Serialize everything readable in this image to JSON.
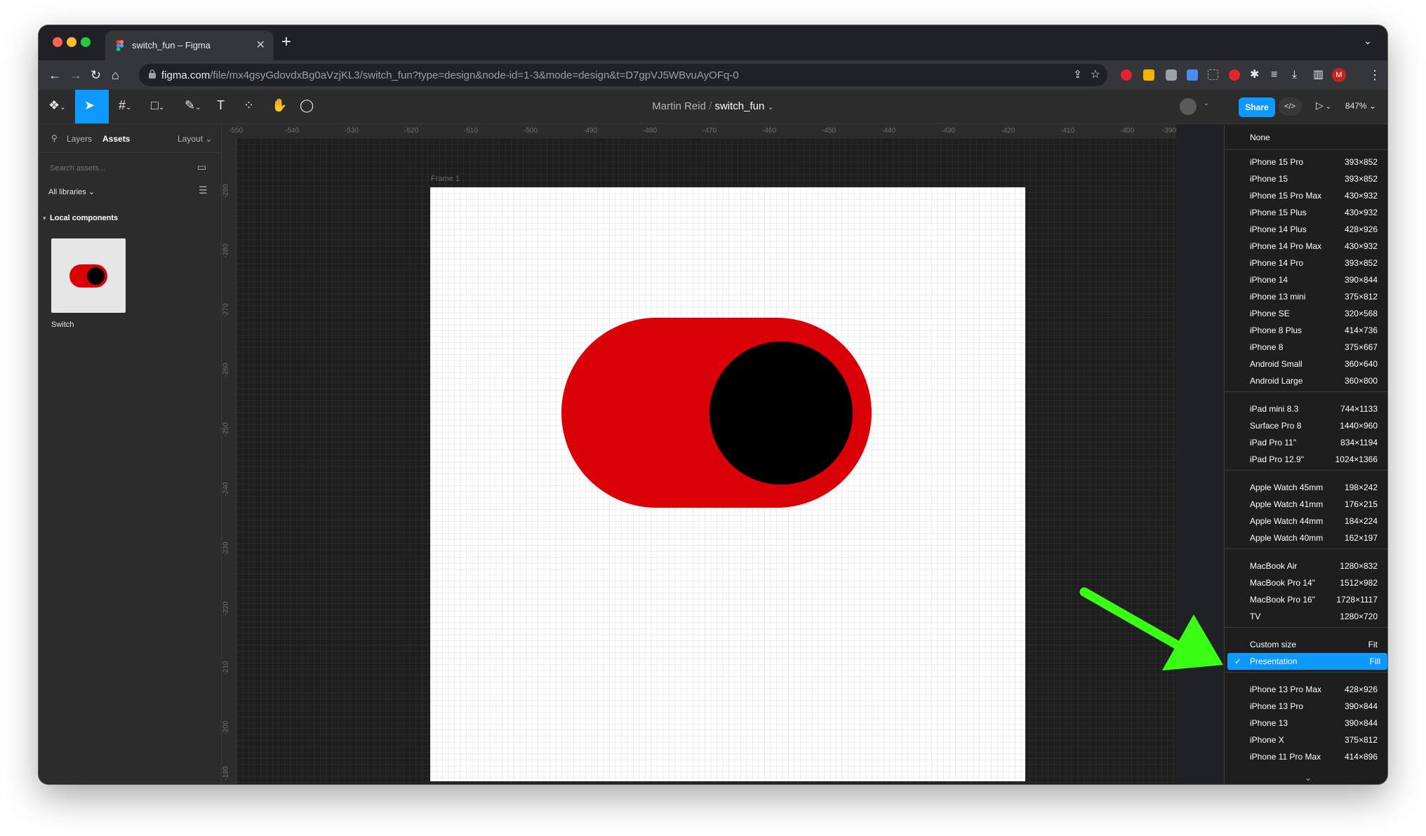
{
  "browser": {
    "tab_title": "switch_fun – Figma",
    "url_host": "figma.com",
    "url_path": "/file/mx4gsyGdovdxBg0aVzjKL3/switch_fun?type=design&node-id=1-3&mode=design&t=D7gpVJ5WBvuAyOFq-0",
    "profile_initial": "M"
  },
  "toolbar": {
    "owner": "Martin Reid",
    "file_name": "switch_fun",
    "share_label": "Share",
    "dev_mode_label": "</>",
    "zoom": "847%"
  },
  "left_panel": {
    "tabs": [
      "Layers",
      "Assets"
    ],
    "layout_label": "Layout",
    "search_placeholder": "Search assets...",
    "libraries_label": "All libraries",
    "section_label": "Local components",
    "component_name": "Switch"
  },
  "rulers": {
    "horizontal": [
      "-550",
      "-540",
      "-530",
      "-520",
      "-510",
      "-500",
      "-490",
      "-480",
      "-470",
      "-460",
      "-450",
      "-440",
      "-430",
      "-420",
      "-410",
      "-400",
      "-390"
    ],
    "vertical": [
      "-290",
      "-280",
      "-270",
      "-260",
      "-250",
      "-240",
      "-230",
      "-220",
      "-210",
      "-200",
      "-190"
    ]
  },
  "canvas": {
    "frame_label": "Frame 1",
    "colors": {
      "track": "#d90008",
      "knob": "#000000",
      "frame": "#ffffff"
    }
  },
  "menu": {
    "none_label": "None",
    "groups": [
      [
        {
          "name": "iPhone 15 Pro",
          "size": "393×852"
        },
        {
          "name": "iPhone 15",
          "size": "393×852"
        },
        {
          "name": "iPhone 15 Pro Max",
          "size": "430×932"
        },
        {
          "name": "iPhone 15 Plus",
          "size": "430×932"
        },
        {
          "name": "iPhone 14 Plus",
          "size": "428×926"
        },
        {
          "name": "iPhone 14 Pro Max",
          "size": "430×932"
        },
        {
          "name": "iPhone 14 Pro",
          "size": "393×852"
        },
        {
          "name": "iPhone 14",
          "size": "390×844"
        },
        {
          "name": "iPhone 13 mini",
          "size": "375×812"
        },
        {
          "name": "iPhone SE",
          "size": "320×568"
        },
        {
          "name": "iPhone 8 Plus",
          "size": "414×736"
        },
        {
          "name": "iPhone 8",
          "size": "375×667"
        },
        {
          "name": "Android Small",
          "size": "360×640"
        },
        {
          "name": "Android Large",
          "size": "360×800"
        }
      ],
      [
        {
          "name": "iPad mini 8.3",
          "size": "744×1133"
        },
        {
          "name": "Surface Pro 8",
          "size": "1440×960"
        },
        {
          "name": "iPad Pro 11\"",
          "size": "834×1194"
        },
        {
          "name": "iPad Pro 12.9\"",
          "size": "1024×1366"
        }
      ],
      [
        {
          "name": "Apple Watch 45mm",
          "size": "198×242"
        },
        {
          "name": "Apple Watch 41mm",
          "size": "176×215"
        },
        {
          "name": "Apple Watch 44mm",
          "size": "184×224"
        },
        {
          "name": "Apple Watch 40mm",
          "size": "162×197"
        }
      ],
      [
        {
          "name": "MacBook Air",
          "size": "1280×832"
        },
        {
          "name": "MacBook Pro 14\"",
          "size": "1512×982"
        },
        {
          "name": "MacBook Pro 16\"",
          "size": "1728×1117"
        },
        {
          "name": "TV",
          "size": "1280×720"
        }
      ],
      [
        {
          "name": "Custom size",
          "size": "Fit"
        },
        {
          "name": "Presentation",
          "size": "Fill",
          "selected": true
        }
      ],
      [
        {
          "name": "iPhone 13 Pro Max",
          "size": "428×926"
        },
        {
          "name": "iPhone 13 Pro",
          "size": "390×844"
        },
        {
          "name": "iPhone 13",
          "size": "390×844"
        },
        {
          "name": "iPhone X",
          "size": "375×812"
        },
        {
          "name": "iPhone 11 Pro Max",
          "size": "414×896"
        }
      ]
    ],
    "more_indicator": "⌄"
  },
  "annotation": {
    "arrow_color": "#39ff14"
  }
}
